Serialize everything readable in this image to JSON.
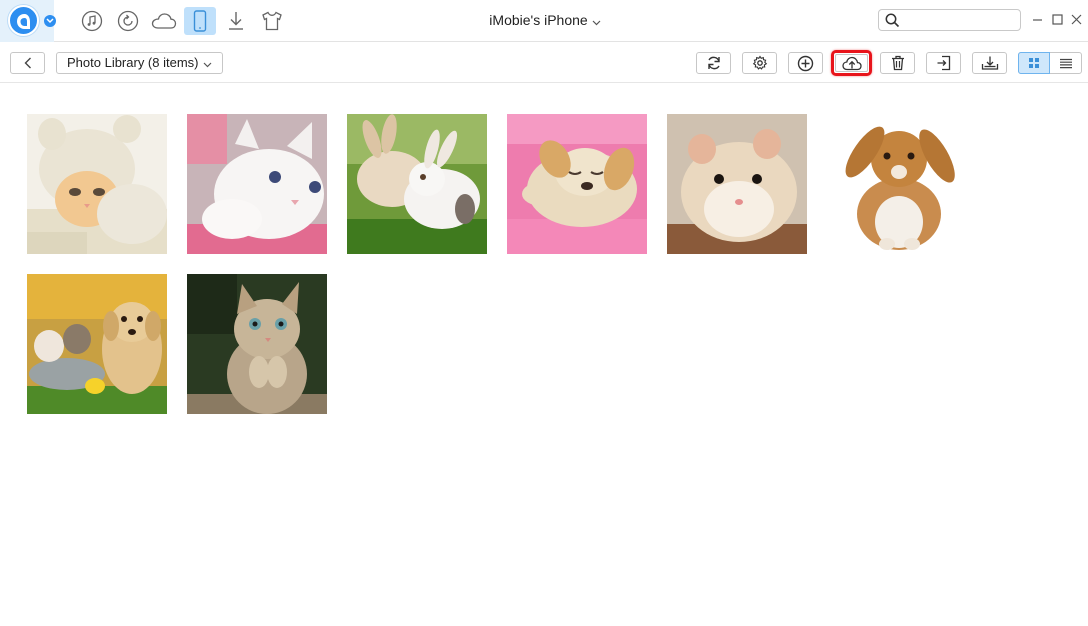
{
  "app": {
    "device_name": "iMobie's iPhone",
    "nav_icons": [
      "music-icon",
      "restore-icon",
      "cloud-icon",
      "phone-icon",
      "download-icon",
      "tshirt-icon"
    ],
    "active_nav": "phone-icon"
  },
  "search": {
    "placeholder": "",
    "value": ""
  },
  "toolbar": {
    "library_label": "Photo Library (8 items)",
    "buttons": [
      "refresh-icon",
      "settings-icon",
      "add-icon",
      "upload-to-cloud-icon",
      "delete-icon",
      "export-to-device-icon",
      "export-to-pc-icon"
    ],
    "highlighted_button": "upload-to-cloud-icon",
    "view_mode": "grid"
  },
  "photos": [
    {
      "subject": "kitten in hat"
    },
    {
      "subject": "white kitten"
    },
    {
      "subject": "two rabbits on grass"
    },
    {
      "subject": "sleeping puppy on pink blanket"
    },
    {
      "subject": "hamster"
    },
    {
      "subject": "brown lop-eared rabbit"
    },
    {
      "subject": "kittens with golden retriever puppy"
    },
    {
      "subject": "tabby kitten looking up"
    }
  ],
  "colors": {
    "accent": "#2d8ef0",
    "active_nav_bg": "#bfe0fb",
    "highlight_border": "#e8141b"
  }
}
